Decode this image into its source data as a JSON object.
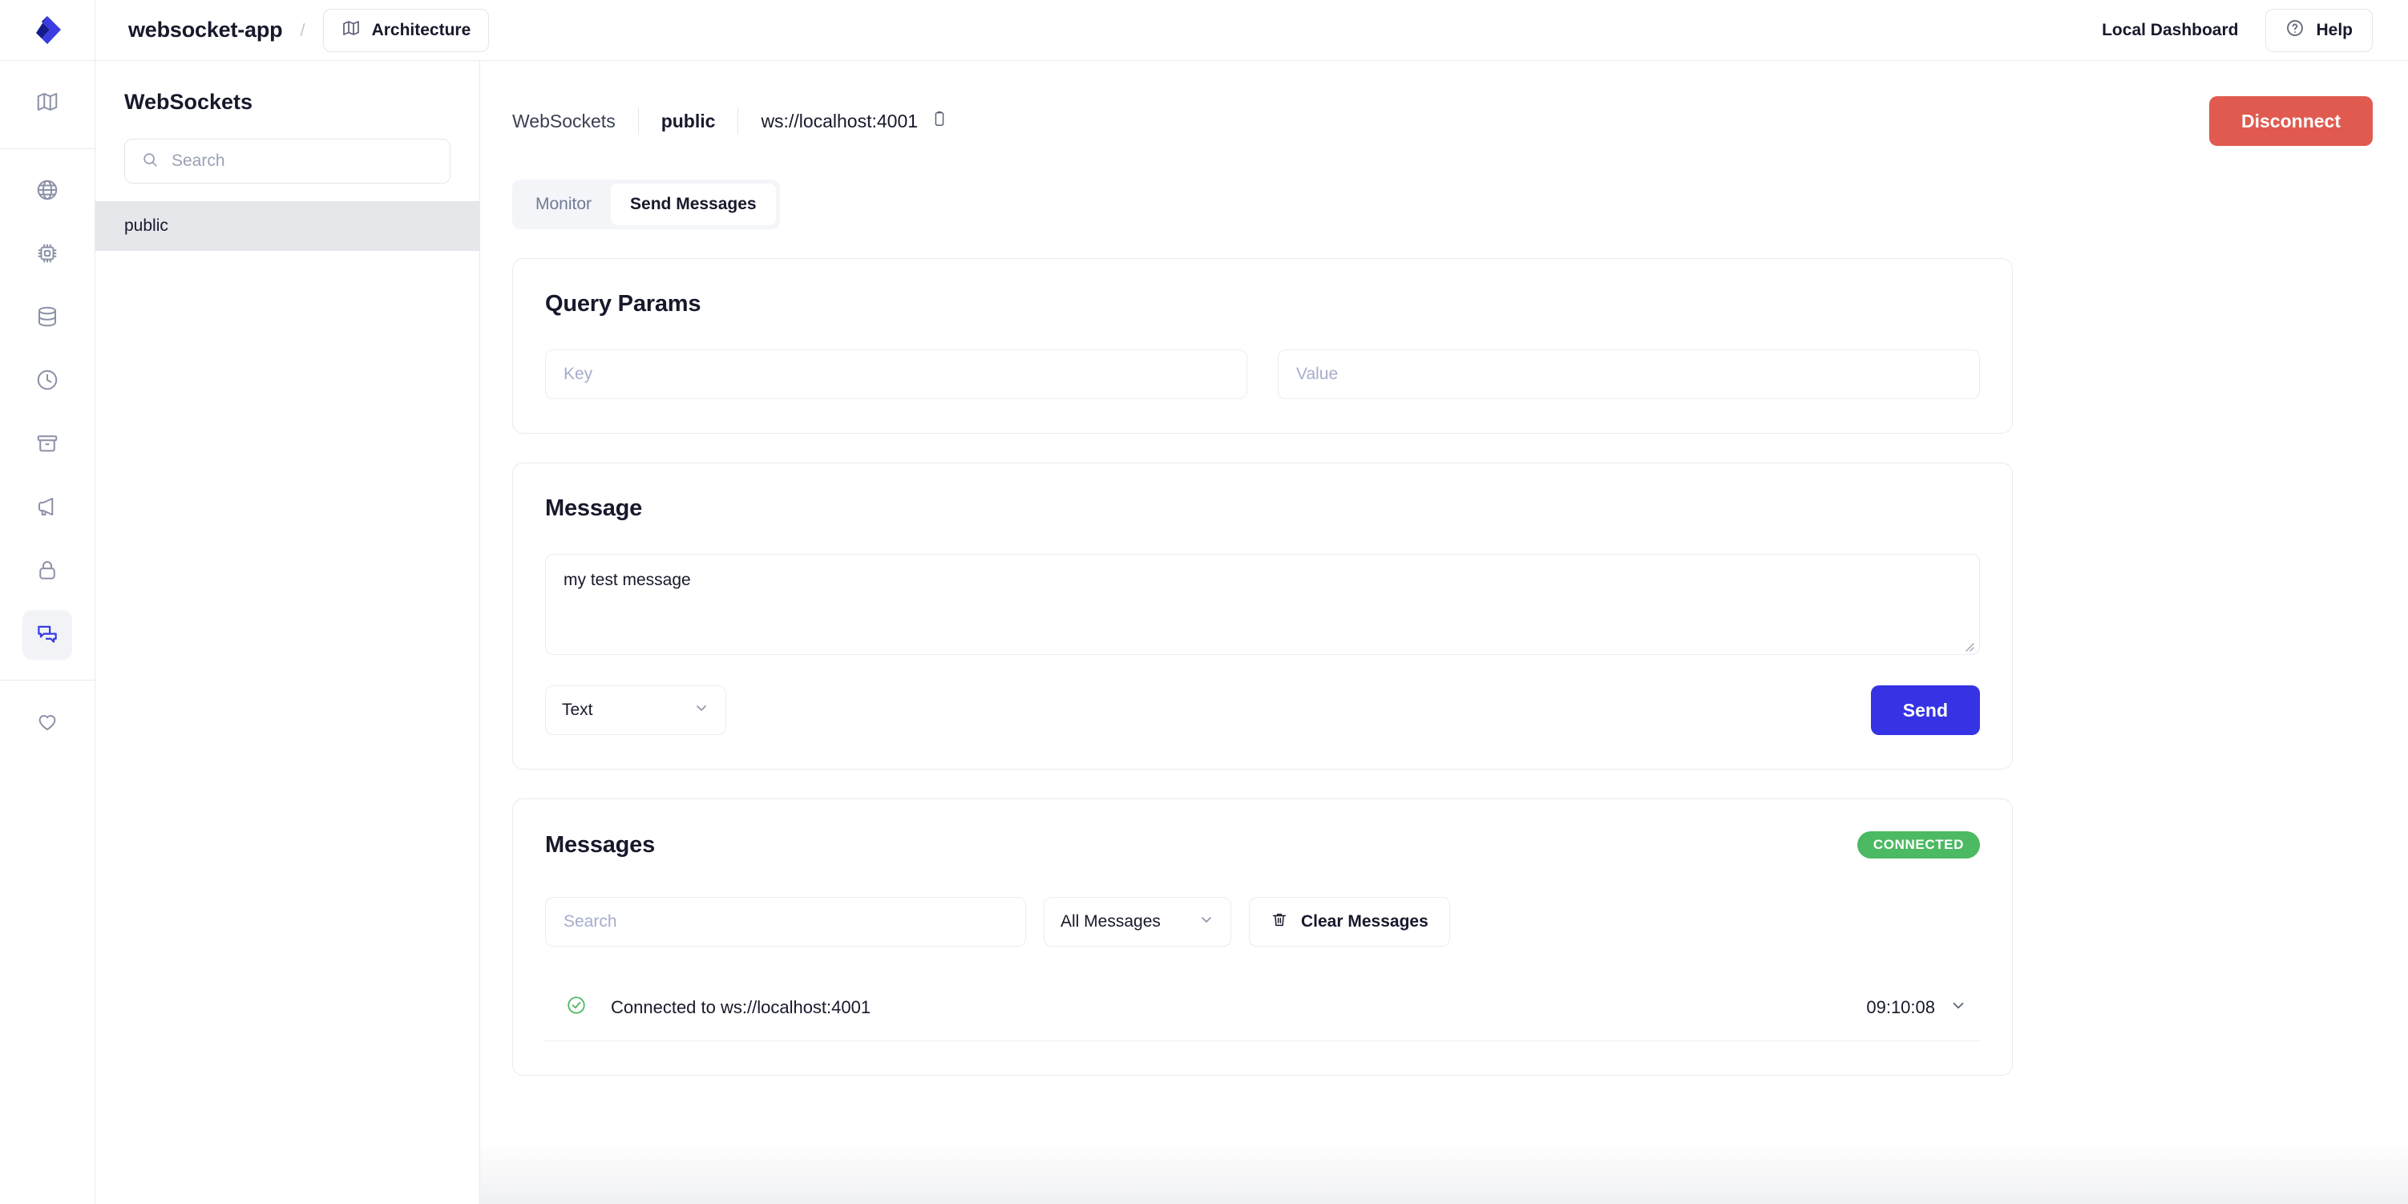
{
  "topbar": {
    "logo_icon": "brand-diamond-logo",
    "project_name": "websocket-app",
    "separator": "/",
    "architecture_label": "Architecture",
    "architecture_icon": "map-icon",
    "local_dashboard_label": "Local Dashboard",
    "help_label": "Help",
    "help_icon": "question-circle-icon"
  },
  "rail": {
    "items": [
      {
        "icon": "map-icon",
        "name": "architecture",
        "active": false
      },
      {
        "icon": "globe-icon",
        "name": "api",
        "active": false
      },
      {
        "icon": "cpu-chip-icon",
        "name": "functions",
        "active": false
      },
      {
        "icon": "database-icon",
        "name": "database",
        "active": false
      },
      {
        "icon": "clock-icon",
        "name": "cron",
        "active": false
      },
      {
        "icon": "archive-box-icon",
        "name": "storage",
        "active": false
      },
      {
        "icon": "megaphone-icon",
        "name": "pubsub",
        "active": false
      },
      {
        "icon": "lock-icon",
        "name": "auth",
        "active": false
      },
      {
        "icon": "chat-bubbles-icon",
        "name": "websockets",
        "active": true
      },
      {
        "icon": "heart-icon",
        "name": "health",
        "active": false
      }
    ]
  },
  "listpanel": {
    "title": "WebSockets",
    "search_placeholder": "Search",
    "search_value": "",
    "search_icon": "search-icon",
    "items": [
      {
        "label": "public",
        "selected": true
      }
    ]
  },
  "main": {
    "breadcrumb": {
      "root": "WebSockets",
      "current": "public",
      "url": "ws://localhost:4001",
      "copy_icon": "clipboard-copy-icon"
    },
    "disconnect_label": "Disconnect",
    "disconnect_color": "#e05a4f",
    "tabs": [
      {
        "label": "Monitor",
        "active": false
      },
      {
        "label": "Send Messages",
        "active": true
      }
    ],
    "query_params": {
      "title": "Query Params",
      "key_placeholder": "Key",
      "key_value": "",
      "value_placeholder": "Value",
      "value_value": ""
    },
    "message": {
      "title": "Message",
      "textarea_value": "my test message",
      "textarea_placeholder": "",
      "format_selected": "Text",
      "format_chevron_icon": "chevron-down-icon",
      "send_label": "Send",
      "send_color": "#3533e3"
    },
    "messages": {
      "title": "Messages",
      "status_badge": "CONNECTED",
      "status_color": "#4cb963",
      "search_placeholder": "Search",
      "search_value": "",
      "filter_selected": "All Messages",
      "filter_chevron_icon": "chevron-down-icon",
      "clear_label": "Clear Messages",
      "clear_icon": "trash-icon",
      "rows": [
        {
          "status_icon": "check-circle-icon",
          "text": "Connected to ws://localhost:4001",
          "time": "09:10:08",
          "expand_icon": "chevron-down-icon"
        }
      ]
    }
  }
}
